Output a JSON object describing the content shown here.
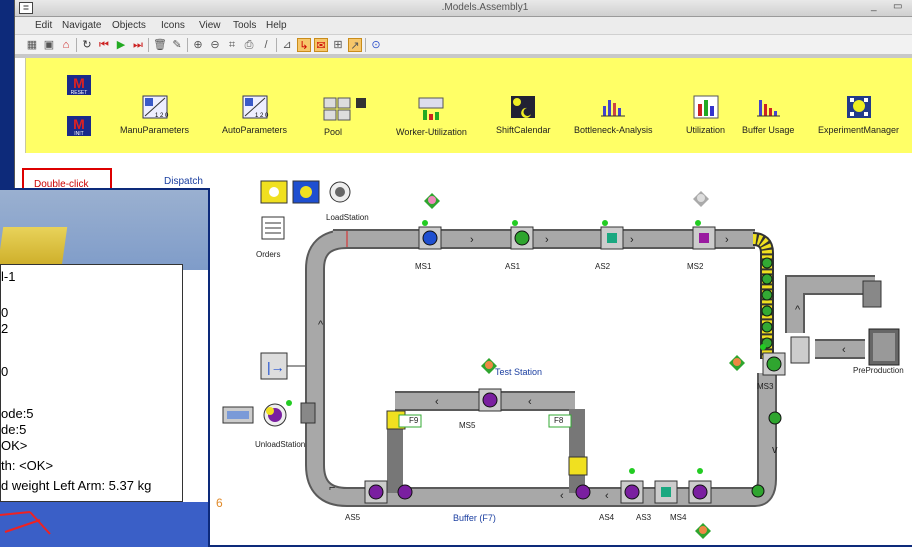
{
  "window": {
    "title": ".Models.Assembly1",
    "minimize": "_",
    "maximize": "▭"
  },
  "menu": [
    "Edit",
    "Navigate",
    "Objects",
    "Icons",
    "View",
    "Tools",
    "Help"
  ],
  "toolbar_icons": [
    "open-icon",
    "save-icon",
    "home-icon",
    "reset-icon",
    "first-icon",
    "play-icon",
    "step-icon",
    "delete-icon",
    "brush-icon",
    "zoom-in-icon",
    "zoom-out-icon",
    "zoom-fit-icon",
    "print-icon",
    "pencil-icon",
    "connector-icon",
    "path-icon",
    "comment-icon",
    "grid-icon",
    "chart-icon",
    "help-icon"
  ],
  "ribbon": {
    "reset": "RESET",
    "init": "INIT",
    "buttons": [
      "ManuParameters",
      "AutoParameters",
      "Pool",
      "Worker-Utilization",
      "ShiftCalendar",
      "Bottleneck-Analysis",
      "Utilization",
      "Buffer Usage",
      "ExperimentManager"
    ]
  },
  "canvas": {
    "doubleclick": "Double-click",
    "dispatch": "Dispatch",
    "labels": {
      "loadstation": "LoadStation",
      "orders": "Orders",
      "ms1": "MS1",
      "as1": "AS1",
      "as2": "AS2",
      "ms2": "MS2",
      "ms3": "MS3",
      "preproduction": "PreProduction",
      "teststation": "Test Station",
      "ms5": "MS5",
      "f9": "F9",
      "f8": "F8",
      "unloadstation": "UnloadStation",
      "as5": "AS5",
      "buffer": "Buffer (F7)",
      "as4": "AS4",
      "as3": "AS3",
      "ms4": "MS4"
    }
  },
  "tooltip_lines": [
    "l-1",
    "0",
    "2",
    "0",
    "ode:5",
    "de:5",
    "OK>",
    "th:  <OK>",
    "d weight Left Arm: 5.37 kg"
  ],
  "stray_six": "6",
  "colors": {
    "ribbon": "#ffff66",
    "conveyor": "#9a9a9a",
    "accent_yellow": "#f0e020",
    "machine_purple": "#7a1fa0",
    "machine_green": "#2fa52f",
    "machine_blue": "#1f4fd0",
    "desktop_blue": "#0d2a7a"
  }
}
